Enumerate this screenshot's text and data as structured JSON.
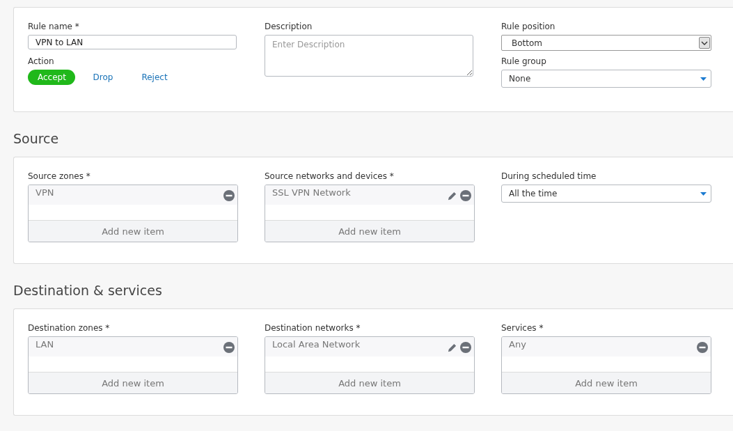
{
  "general": {
    "rule_name": {
      "label": "Rule name *",
      "value": "VPN to LAN"
    },
    "action": {
      "label": "Action",
      "options": [
        {
          "label": "Accept",
          "selected": true
        },
        {
          "label": "Drop",
          "selected": false
        },
        {
          "label": "Reject",
          "selected": false
        }
      ]
    },
    "description": {
      "label": "Description",
      "placeholder": "Enter Description"
    },
    "rule_position": {
      "label": "Rule position",
      "kind": "native",
      "value": "Bottom"
    },
    "rule_group": {
      "label": "Rule group",
      "kind": "dropdown",
      "value": "None"
    }
  },
  "sections": [
    {
      "title": "Source",
      "fields": [
        {
          "kind": "list",
          "label": "Source zones *",
          "items": [
            {
              "text": "VPN",
              "editable": false
            }
          ],
          "add_label": "Add new item"
        },
        {
          "kind": "list",
          "label": "Source networks and devices *",
          "items": [
            {
              "text": "SSL VPN Network",
              "editable": true
            }
          ],
          "add_label": "Add new item"
        },
        {
          "kind": "dropdown",
          "label": "During scheduled time",
          "value": "All the time"
        }
      ]
    },
    {
      "title": "Destination & services",
      "fields": [
        {
          "kind": "list",
          "label": "Destination zones *",
          "items": [
            {
              "text": "LAN",
              "editable": false
            }
          ],
          "add_label": "Add new item"
        },
        {
          "kind": "list",
          "label": "Destination networks *",
          "items": [
            {
              "text": "Local Area Network",
              "editable": true
            }
          ],
          "add_label": "Add new item"
        },
        {
          "kind": "list",
          "label": "Services *",
          "items": [
            {
              "text": "Any",
              "editable": false
            }
          ],
          "add_label": "Add new item"
        }
      ]
    }
  ]
}
